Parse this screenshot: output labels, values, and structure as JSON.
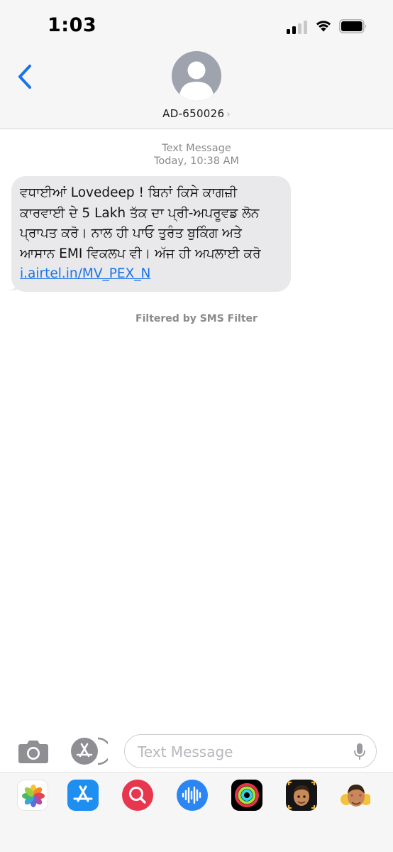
{
  "status_bar": {
    "time": "1:03"
  },
  "header": {
    "contact_name": "AD-650026",
    "chevron": "›",
    "back_icon": "chevron-left-icon",
    "avatar_icon": "person-silhouette-icon"
  },
  "conversation": {
    "message_type": "Text Message",
    "timestamp": "Today, 10:38 AM",
    "message_text": "ਵਧਾਈਆਂ Lovedeep ! ਬਿਨਾਂ ਕਿਸੇ ਕਾਗਜ਼ੀ ਕਾਰਵਾਈ ਦੇ 5 Lakh ਤੱਕ ਦਾ ਪ੍ਰੀ-ਅਪਰੂਵਡ ਲੋਨ ਪ੍ਰਾਪਤ ਕਰੋ। ਨਾਲ ਹੀ ਪਾਓ ਤੁਰੰਤ ਬੁਕਿੰਗ ਅਤੇ ਆਸਾਨ EMI ਵਿਕਲਪ ਵੀ। ਅੱਜ ਹੀ ਅਪਲਾਈ ਕਰੋ ",
    "message_link": "i.airtel.in/MV_PEX_N",
    "filter_note": "Filtered by SMS Filter"
  },
  "composer": {
    "placeholder": "Text Message",
    "camera_icon": "camera-icon",
    "apps_icon": "app-store-icon",
    "mic_icon": "microphone-icon"
  },
  "app_drawer": [
    {
      "name": "photos-app-icon"
    },
    {
      "name": "app-store-app-icon"
    },
    {
      "name": "search-images-app-icon"
    },
    {
      "name": "audio-message-app-icon"
    },
    {
      "name": "activity-app-icon"
    },
    {
      "name": "memoji-app-icon"
    },
    {
      "name": "memoji-stickers-app-icon"
    }
  ],
  "colors": {
    "link": "#1a73e8",
    "accent": "#1a73e8",
    "bubble": "#e9e9eb",
    "meta_text": "#8a8a8e"
  }
}
